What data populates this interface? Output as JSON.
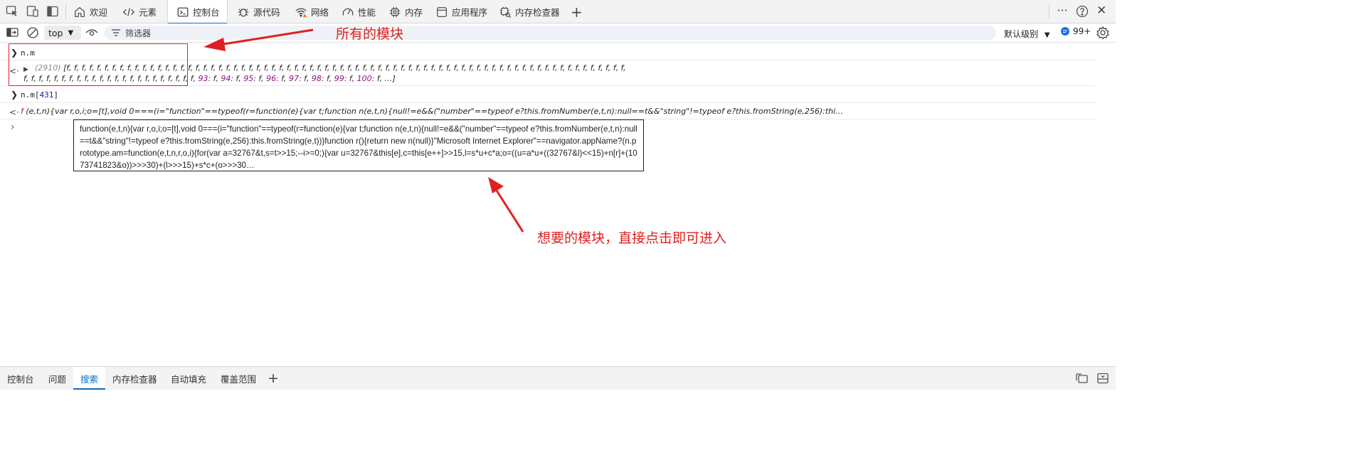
{
  "tabs": [
    {
      "label": "欢迎",
      "icon": "home-icon"
    },
    {
      "label": "元素",
      "icon": "code-icon"
    },
    {
      "label": "控制台",
      "icon": "console-icon"
    },
    {
      "label": "源代码",
      "icon": "bug-icon"
    },
    {
      "label": "网络",
      "icon": "wifi-warning-icon"
    },
    {
      "label": "性能",
      "icon": "gauge-icon"
    },
    {
      "label": "内存",
      "icon": "chip-icon"
    },
    {
      "label": "应用程序",
      "icon": "app-window-icon"
    },
    {
      "label": "内存检查器",
      "icon": "memory-inspector-icon"
    }
  ],
  "toolbar": {
    "context": "top",
    "filter_placeholder": "筛选器",
    "level": "默认级别",
    "issues_count": "99+"
  },
  "console": {
    "cmd1": "n.m",
    "out1_count": "(2910)",
    "out1_line1": "[f, f, f, f, f, f, f, f, f, f, f, f, f, f, f, f, f, f, f, f, f, f, f, f, f, f, f, f, f, f, f, f, f, f, f, f, f, f, f, f, f, f, f, f, f, f, f, f, f, f, f, f, f, f, f, f, f, f, f, f, f, f, f, f, f, f, f, f, f, f, f, f, f, f,",
    "out1_line2_start": "f, f, f, f, f, f, f, f, f, f, f, f, f, f, f, f, f, f, f, f, f, f, f, ",
    "out1_tail": [
      {
        "k": "93",
        "v": "f"
      },
      {
        "k": "94",
        "v": "f"
      },
      {
        "k": "95",
        "v": "f"
      },
      {
        "k": "96",
        "v": "f"
      },
      {
        "k": "97",
        "v": "f"
      },
      {
        "k": "98",
        "v": "f"
      },
      {
        "k": "99",
        "v": "f"
      },
      {
        "k": "100",
        "v": "f"
      }
    ],
    "out1_end": "…]",
    "cmd2_obj": "n.m[",
    "cmd2_index": "431",
    "cmd2_close": "]",
    "out2_f": "f",
    "out2_text": "(e,t,n){var r,o,i;o=[t],void 0===(i=\"function\"==typeof(r=function(e){var t;function n(e,t,n){null!=e&&(\"number\"==typeof e?this.fromNumber(e,t,n):null==t&&\"string\"!=typeof e?this.fromString(e,256):thi…"
  },
  "tooltip_text": "function(e,t,n){var r,o,i;o=[t],void 0===(i=\"function\"==typeof(r=function(e){var t;function n(e,t,n){null!=e&&(\"number\"==typeof e?this.fromNumber(e,t,n):null==t&&\"string\"!=typeof e?this.fromString(e,256):this.fromString(e,t))}function r(){return new n(null)}\"Microsoft Internet Explorer\"==navigator.appName?(n.prototype.am=function(e,t,n,r,o,i){for(var a=32767&t,s=t>>15;--i>=0;){var u=32767&this[e],c=this[e++]>>15,l=s*u+c*a;o=((u=a*u+((32767&l)<<15)+n[r]+(1073741823&o))>>>30)+(l>>>15)+s*c+(o>>>30…",
  "annotations": {
    "top": "所有的模块",
    "bottom": "想要的模块，直接点击即可进入"
  },
  "drawer_tabs": [
    "控制台",
    "问题",
    "搜索",
    "内存检查器",
    "自动填充",
    "覆盖范围"
  ],
  "colors": {
    "accent": "#0f6cbd",
    "annotation": "#e02020"
  }
}
